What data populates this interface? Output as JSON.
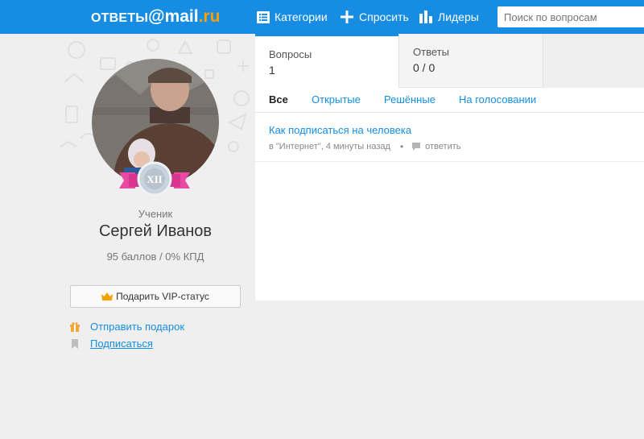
{
  "header": {
    "logo_part1": "ОТВЕТЫ",
    "logo_part2": "@mail",
    "logo_part3": ".ru",
    "nav": [
      "Категории",
      "Спросить",
      "Лидеры"
    ],
    "search_placeholder": "Поиск по вопросам"
  },
  "profile": {
    "badge": "XII",
    "rank": "Ученик",
    "name": "Сергей Иванов",
    "score": "95 баллов / 0% КПД",
    "vip_button": "Подарить VIP-статус",
    "gift_link": "Отправить подарок",
    "subscribe_link": "Подписаться"
  },
  "stats": {
    "questions_label": "Вопросы",
    "questions_value": "1",
    "answers_label": "Ответы",
    "answers_value": "0 / 0"
  },
  "filters": [
    "Все",
    "Открытые",
    "Решённые",
    "На голосовании"
  ],
  "active_filter": "Все",
  "questions": [
    {
      "title": "Как подписаться на человека",
      "meta": "в \"Интернет\", 4 минуты назад",
      "reply": "ответить"
    }
  ],
  "colors": {
    "accent": "#168de2",
    "logo_ru": "#ff9e00",
    "badge_ribbon": "#e84aa3",
    "background": "#efefef"
  }
}
